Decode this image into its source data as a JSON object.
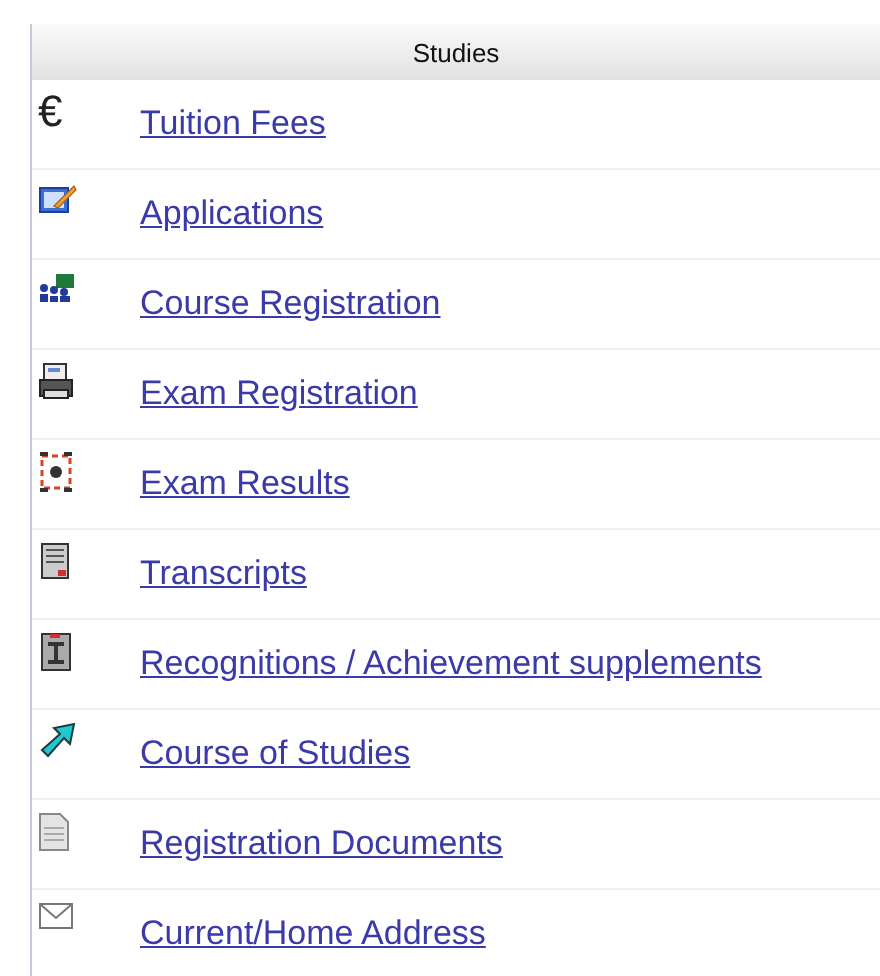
{
  "header": {
    "title": "Studies"
  },
  "items": [
    {
      "kind": "euro",
      "symbol": "€",
      "label": "Tuition Fees"
    },
    {
      "kind": "pencil",
      "label": "Applications"
    },
    {
      "kind": "people",
      "label": "Course Registration"
    },
    {
      "kind": "printer",
      "label": "Exam Registration"
    },
    {
      "kind": "results",
      "label": "Exam Results"
    },
    {
      "kind": "document",
      "label": "Transcripts"
    },
    {
      "kind": "certificate",
      "label": "Recognitions / Achievement supplements"
    },
    {
      "kind": "arrow",
      "label": "Course of Studies"
    },
    {
      "kind": "page",
      "label": "Registration Documents"
    },
    {
      "kind": "envelope",
      "label": "Current/Home Address"
    }
  ]
}
